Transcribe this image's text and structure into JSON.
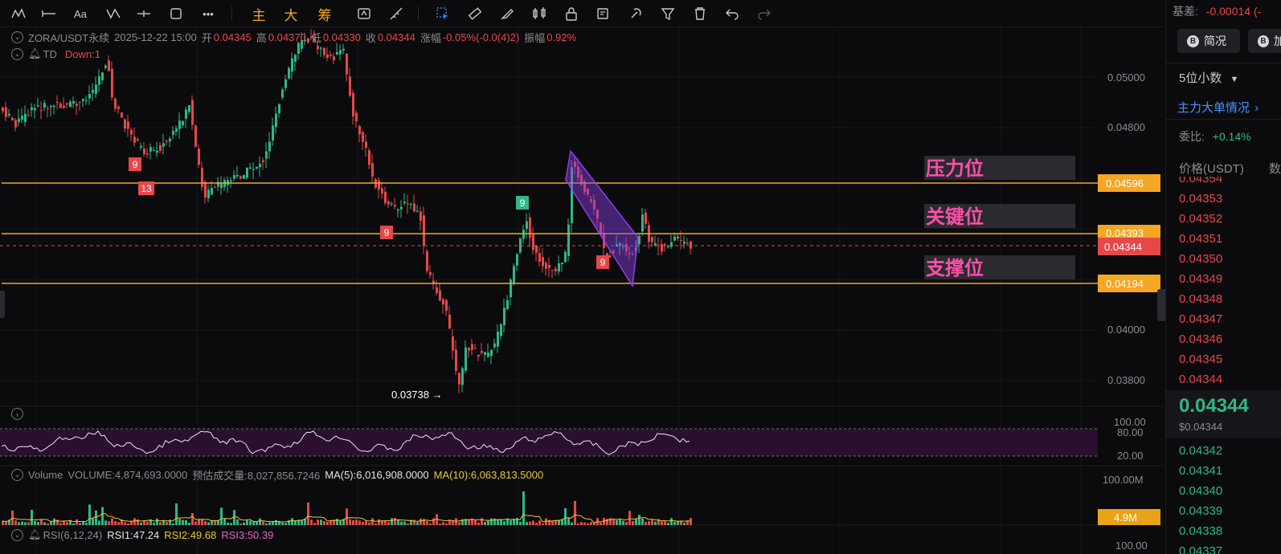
{
  "toolbar": {
    "cn_tools": [
      "主",
      "大",
      "筹"
    ],
    "icons": [
      "indicator-icon",
      "line-icon",
      "text-tool-icon",
      "trend-icon",
      "crosshair-icon",
      "rectangle-icon",
      "more-icon",
      "screenshot-icon",
      "ruler-icon",
      "select-icon",
      "measure-icon",
      "brush-icon",
      "candle-icon",
      "lock-icon",
      "edit-icon",
      "magnet-icon",
      "filter-icon",
      "delete-icon",
      "undo-icon",
      "redo-icon"
    ]
  },
  "legend": {
    "symbol": "ZORA/USDT永续",
    "datetime": "2025-12-22 15:00",
    "open_label": "开",
    "open": "0.04345",
    "high_label": "高",
    "high": "0.04370",
    "low_label": "低",
    "low": "0.04330",
    "close_label": "收",
    "close": "0.04344",
    "change_label": "涨幅",
    "change": "-0.05%(-0.0(4)2)",
    "amp_label": "振幅",
    "amp": "0.92%",
    "td_label": "TD",
    "td_value": "Down:1"
  },
  "price_axis": {
    "ticks": [
      "0.05000",
      "0.04800",
      "0.04000",
      "0.03800"
    ],
    "resistance": "0.04596",
    "key": "0.04393",
    "current": "0.04344",
    "support": "0.04194",
    "low_marker": "0.03738 →"
  },
  "annotations": {
    "resistance_label": "压力位",
    "key_label": "关键位",
    "support_label": "支撑位",
    "td_marks": [
      "9",
      "13",
      "9",
      "9",
      "9"
    ]
  },
  "rsi_panel": {
    "ticks": [
      "100.00",
      "80.00",
      "20.00"
    ]
  },
  "volume": {
    "label": "Volume",
    "volume": "VOLUME:4,874,693.0000",
    "est": "预估成交量:8,027,856.7246",
    "ma5": "MA(5):6,016,908.0000",
    "ma10": "MA(10):6,063,813.5000",
    "axis_top": "100.00M",
    "current": "4.9M"
  },
  "rsi_legend": {
    "label": "RSI(6,12,24)",
    "rsi1": "RSI1:47.24",
    "rsi2": "RSI2:49.68",
    "rsi3": "RSI3:50.39",
    "axis_bottom": "100.00"
  },
  "right_panel": {
    "basis_label": "基差:",
    "basis_value": "-0.00014 (-",
    "btn_simple": "简况",
    "btn_add": "加",
    "decimals": "5位小数",
    "main_orders": "主力大单情况",
    "ratio_label": "委比:",
    "ratio_value": "+0.14%",
    "price_header": "价格(USDT)",
    "qty_header": "数",
    "asks": [
      "0.04354",
      "0.04353",
      "0.04352",
      "0.04351",
      "0.04350",
      "0.04349",
      "0.04348",
      "0.04347",
      "0.04346",
      "0.04345",
      "0.04344"
    ],
    "last_price": "0.04344",
    "last_usd": "$0.04344",
    "bids": [
      "0.04342",
      "0.04341",
      "0.04340",
      "0.04339",
      "0.04338",
      "0.04337"
    ]
  },
  "colors": {
    "up": "#2eb886",
    "down": "#e6484a",
    "level": "#f5a623",
    "channel": "#8a3fe8",
    "label": "#ff4fa8"
  }
}
